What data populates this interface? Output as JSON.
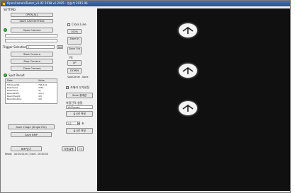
{
  "window": {
    "title": "OpenCameraTester_v1.02 2018 v1.2025 - 빔분석 2015.06"
  },
  "settings": {
    "group_label": "SETTING",
    "open_all_button": "OPEN ALL",
    "save_settings_button": "SAVE CAM SETTING"
  },
  "camera": {
    "open_button": "Open Camera",
    "field1": "",
    "field2": "",
    "trigger_label": "Trigger Selection",
    "trigger_value": "2",
    "trigger_set": "Set",
    "start_button": "Start Camera",
    "stop_button": "Stop Camera",
    "close_button": "Close Camera"
  },
  "spot": {
    "label": "Spot Result",
    "table": {
      "headers": [
        "Data",
        "Value"
      ],
      "rows": [
        [
          "TotalCalcSZ",
          "786,421"
        ],
        [
          "PeakValue",
          "2551"
        ],
        [
          "BaseValue",
          "41"
        ],
        [
          "BeamWidth",
          "4.8.3"
        ],
        [
          "BeamHeight",
          "4.8"
        ],
        [
          "BeamPosition",
          "4.8"
        ]
      ]
    },
    "save_single_button": "Save Image (Single File)",
    "save_bmp_button": "Save BMP",
    "save_bmp_close_button": "BMP닫기",
    "auto_start_button": "자동실행",
    "small_button": "도움",
    "status_text": "Ready - 00:00:00.00 | Start - 00:00:00"
  },
  "view_controls": {
    "check_label": "Cross Line",
    "zoom_100": "100%",
    "zoom_in": "Zoom In",
    "zoom_out": "Zoom Out",
    "fit_label": "Fit",
    "up_button": "UP",
    "down_button": "DOWN",
    "beam_center_label": "SpotCenter - None"
  },
  "analysis": {
    "check_label": "카메라 부가설정",
    "save_analysis_button": "Save 결과값",
    "interval_label": "측정간격 설정",
    "interval_value": "1000msec",
    "realtime_button": "실시간 측정",
    "spin_value": "1.0",
    "unit_label": "초"
  },
  "colors": {
    "title_bar": "#2c4f94",
    "status_led": "#3cb84a",
    "image_background": "#101010",
    "blob": "#f4f4f4"
  }
}
